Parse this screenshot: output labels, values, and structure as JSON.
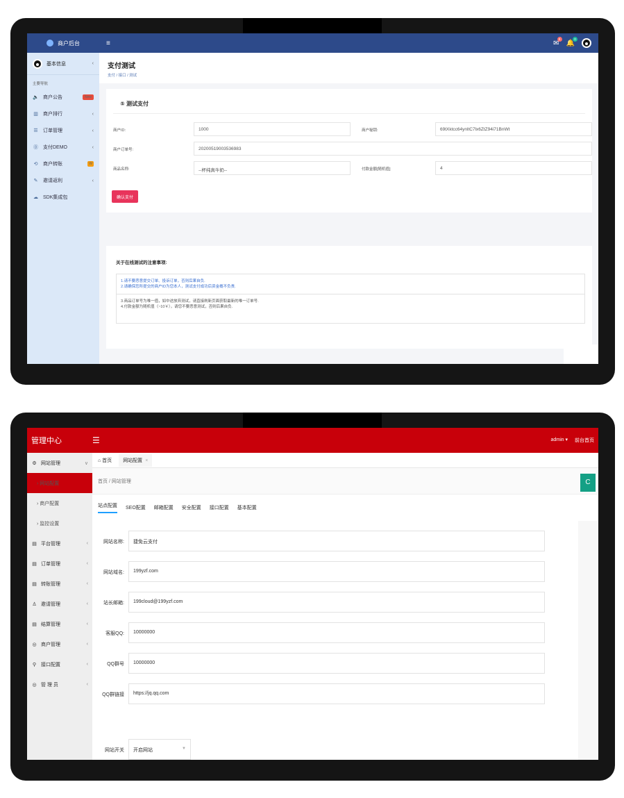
{
  "screen1": {
    "brand": "商户后台",
    "user": {
      "name": "基本信息"
    },
    "section_label": "主要导航",
    "nav": [
      {
        "icon": "speaker-icon",
        "glyph": "🔈",
        "label": "商户公告",
        "badge": "New"
      },
      {
        "icon": "chart-icon",
        "glyph": "▥",
        "label": "商户排行",
        "tail": "‹"
      },
      {
        "icon": "list-icon",
        "glyph": "☰",
        "label": "订单管理",
        "tail": "‹"
      },
      {
        "icon": "yen-icon",
        "glyph": "⓪",
        "label": "支付DEMO",
        "tail": "‹"
      },
      {
        "icon": "transfer-icon",
        "glyph": "⟲",
        "label": "商户转账",
        "badge_sq": "W"
      },
      {
        "icon": "edit-icon",
        "glyph": "✎",
        "label": "邀请返利",
        "tail": "‹"
      },
      {
        "icon": "cloud-icon",
        "glyph": "☁",
        "label": "SDK集成包"
      }
    ],
    "topbar": {
      "menu": "≡",
      "mail_count": "0",
      "bell_count": "0"
    },
    "page": {
      "title": "支付测试",
      "breadcrumb": "支付 / 接口 / 测试"
    },
    "card": {
      "title": "⑤ 测试支付",
      "fields": {
        "merchant_id_label": "商户ID:",
        "merchant_id": "1000",
        "merchant_key_label": "商户秘钥:",
        "merchant_key": "69tXktcc64ynltC7lx6ZtZ94i71BnWt",
        "order_no_label": "商户订单号:",
        "order_no": "20200519003536983",
        "product_label": "商品名称:",
        "product": "--杯纯真牛奶--",
        "amount_label": "付款金额[随机值]",
        "amount": "4"
      },
      "submit": "确认支付"
    },
    "notice": {
      "title": "关于在线测试的注意事项:",
      "p1_line1": "1.请不要恶意提交订单、投诉订单，否则后果自负.",
      "p1_line2": "2.请确保您所提交的商户ID为您本人，测试支付成功后资金概不负责.",
      "p2_line1": "3.商品订单号为唯一值，如中途放弃测试，请直接刷新页面获取最新的唯一订单号.",
      "p2_line2": "4.付款金额为随机值（~10￥），请您不要恶意测试，否则后果自负."
    }
  },
  "screen2": {
    "brand": "管理中心",
    "menu": "☰",
    "user": "admin ▾",
    "frontpage": "前台首页",
    "sidebar": [
      {
        "name": "nav-site-manage",
        "icon": "gear-icon",
        "glyph": "⚙",
        "label": "网站管理",
        "tail": "∨"
      },
      {
        "name": "nav-site-config",
        "label": "› 网站配置",
        "active": true,
        "sub": true
      },
      {
        "name": "nav-merchant-config",
        "label": "› 商户配置",
        "sub": true
      },
      {
        "name": "nav-monitor-config",
        "label": "› 监控设置",
        "sub": true
      },
      {
        "name": "nav-platform-manage",
        "icon": "doc-icon",
        "glyph": "▤",
        "label": "平台管理",
        "tail": "‹"
      },
      {
        "name": "nav-order-manage",
        "icon": "doc-icon",
        "glyph": "▤",
        "label": "订单管理",
        "tail": "‹"
      },
      {
        "name": "nav-transfer-manage",
        "icon": "doc-icon",
        "glyph": "▤",
        "label": "转账管理",
        "tail": "‹"
      },
      {
        "name": "nav-invite-manage",
        "icon": "user-icon",
        "glyph": "♙",
        "label": "邀请管理",
        "tail": "‹"
      },
      {
        "name": "nav-settle-manage",
        "icon": "doc-icon",
        "glyph": "▤",
        "label": "结算管理",
        "tail": "‹"
      },
      {
        "name": "nav-merchant-manage",
        "icon": "coin-icon",
        "glyph": "◎",
        "label": "商户管理",
        "tail": "‹"
      },
      {
        "name": "nav-api-config",
        "icon": "plug-icon",
        "glyph": "⚲",
        "label": "接口配置",
        "tail": "‹"
      },
      {
        "name": "nav-admin",
        "icon": "coin-icon",
        "glyph": "◎",
        "label": "管 理 员",
        "tail": "‹"
      }
    ],
    "tabs": {
      "home": "⌂ 首页",
      "current": "网站配置",
      "close": "×"
    },
    "breadcrumb": "首页 / 网站管理",
    "refresh": "C",
    "subtabs": [
      "站点配置",
      "SEO配置",
      "邮箱配置",
      "安全配置",
      "接口配置",
      "基本配置"
    ],
    "form": [
      {
        "label": "网站名称:",
        "value": "捷免云支付"
      },
      {
        "label": "网站域名:",
        "value": "199yzf.com"
      },
      {
        "label": "站长邮箱:",
        "value": "199cloud@199yzf.com"
      },
      {
        "label": "客服QQ:",
        "value": "10000000"
      },
      {
        "label": "QQ群号",
        "value": "10000000"
      },
      {
        "label": "QQ群链接",
        "value": "https://jq.qq.com"
      }
    ],
    "switch": {
      "label": "网站开关",
      "value": "开启网站"
    }
  }
}
